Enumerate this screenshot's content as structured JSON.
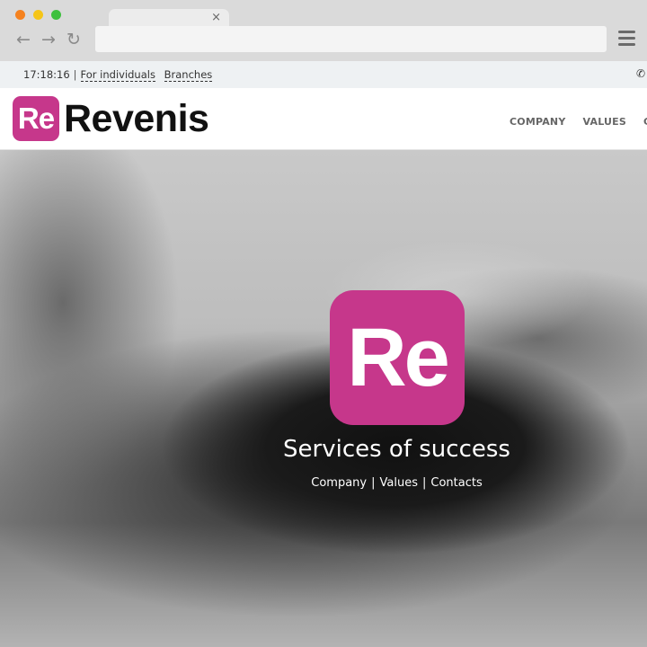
{
  "browser": {
    "tab_close": "×",
    "nav_icons": {
      "back": "back-arrow-icon",
      "forward": "forward-arrow-icon",
      "reload": "reload-icon"
    },
    "menu_icon": "hamburger-menu-icon",
    "url": ""
  },
  "topbar": {
    "time": "17:18:16",
    "separator": "|",
    "link_individuals": "For individuals",
    "link_branches": "Branches",
    "phone_icon": "phone-icon"
  },
  "header": {
    "logo_badge": "Re",
    "logo_text": "Revenis",
    "nav": [
      "COMPANY",
      "VALUES",
      "CA"
    ]
  },
  "hero": {
    "badge": "Re",
    "title": "Services of success",
    "links": [
      "Company",
      "Values",
      "Contacts"
    ],
    "separator": "|"
  },
  "colors": {
    "brand": "#c6378b",
    "topbar_bg": "#eef1f3",
    "chrome_bg": "#dadada"
  }
}
